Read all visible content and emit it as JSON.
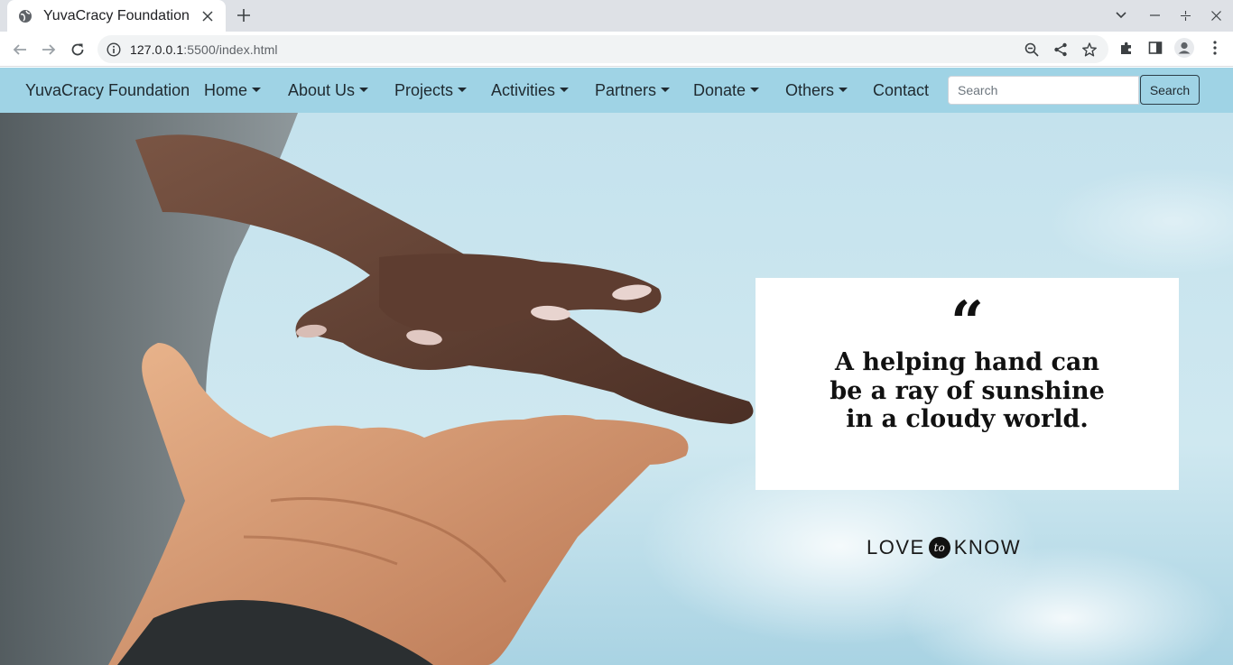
{
  "browser": {
    "tab_title": "YuvaCracy Foundation",
    "url_host": "127.0.0.1",
    "url_rest": ":5500/index.html"
  },
  "site": {
    "brand": "YuvaCracy Foundation",
    "nav": [
      {
        "label": "Home",
        "dropdown": true
      },
      {
        "label": "About Us",
        "dropdown": true
      },
      {
        "label": "Projects",
        "dropdown": true
      },
      {
        "label": "Activities",
        "dropdown": true
      },
      {
        "label": "Partners",
        "dropdown": true
      },
      {
        "label": "Donate",
        "dropdown": true
      },
      {
        "label": "Others",
        "dropdown": true
      },
      {
        "label": "Contact",
        "dropdown": false
      }
    ],
    "search_placeholder": "Search",
    "search_button": "Search",
    "navbar_color": "#9fd3e5"
  },
  "hero": {
    "quote_mark": "“",
    "quote_text": "A helping hand can be a ray of sunshine in a cloudy world.",
    "logo_left": "LOVE",
    "logo_mid": "to",
    "logo_right": "KNOW"
  }
}
